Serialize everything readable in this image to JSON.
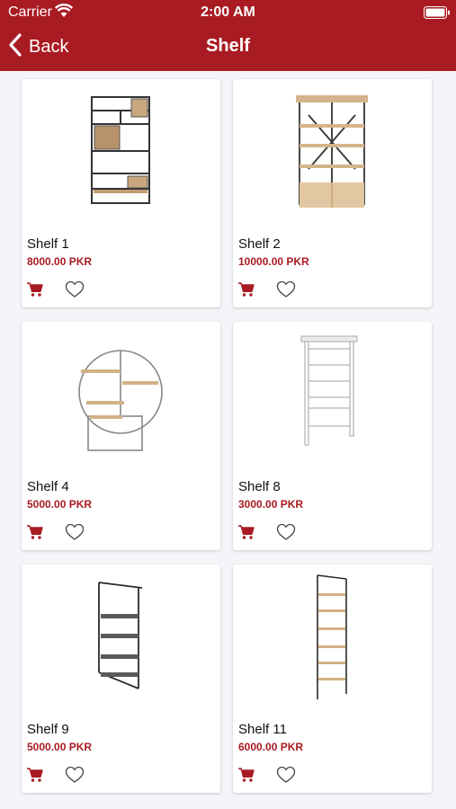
{
  "status": {
    "carrier": "Carrier",
    "time": "2:00 AM"
  },
  "nav": {
    "back_label": "Back",
    "title": "Shelf"
  },
  "colors": {
    "brand": "#a91b22",
    "price": "#a91b22"
  },
  "products": [
    {
      "name": "Shelf 1",
      "price": "8000.00 PKR"
    },
    {
      "name": "Shelf 2",
      "price": "10000.00 PKR"
    },
    {
      "name": "Shelf 4",
      "price": "5000.00 PKR"
    },
    {
      "name": "Shelf 8",
      "price": "3000.00 PKR"
    },
    {
      "name": "Shelf 9",
      "price": "5000.00 PKR"
    },
    {
      "name": "Shelf 11",
      "price": "6000.00 PKR"
    }
  ]
}
